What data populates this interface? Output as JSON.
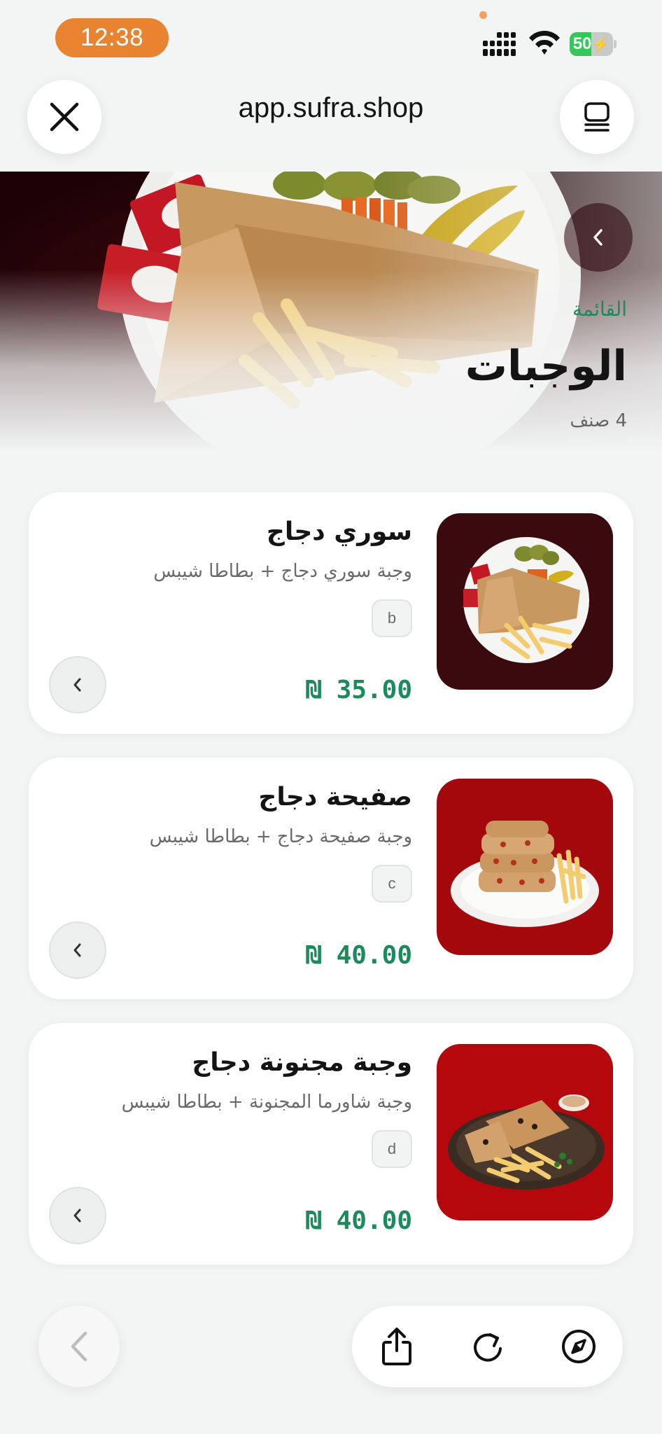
{
  "status_bar": {
    "time": "12:38",
    "battery_text": "50",
    "battery_level": 0.5
  },
  "browser": {
    "url": "app.sufra.shop"
  },
  "category": {
    "eyebrow": "القائمة",
    "title": "الوجبات",
    "count": "4 صنف"
  },
  "items": [
    {
      "title": "سوري دجاج",
      "description": "وجبة سوري دجاج + بطاطا شيبس",
      "code": "b",
      "price": "₪ 35.00",
      "image_bg": "#3a0a0e"
    },
    {
      "title": "صفيحة دجاج",
      "description": "وجبة صفيحة دجاج + بطاطا شيبس",
      "code": "c",
      "price": "₪ 40.00",
      "image_bg": "#a3080c"
    },
    {
      "title": "وجبة مجنونة دجاج",
      "description": "وجبة شاورما المجنونة + بطاطا شيبس",
      "code": "d",
      "price": "₪ 40.00",
      "image_bg": "#b4080c"
    }
  ],
  "colors": {
    "accent_green": "#1c8a5c",
    "time_pill": "#e8832f",
    "battery_green": "#34c759",
    "background": "#f3f4f4"
  },
  "icons": {
    "close": "close-icon",
    "tabs": "tabs-icon",
    "hero_back": "chevron-left-icon",
    "card_go": "chevron-left-icon",
    "bottom_back": "back-arrow-icon",
    "share": "share-icon",
    "reload": "reload-icon",
    "compass": "compass-icon"
  }
}
